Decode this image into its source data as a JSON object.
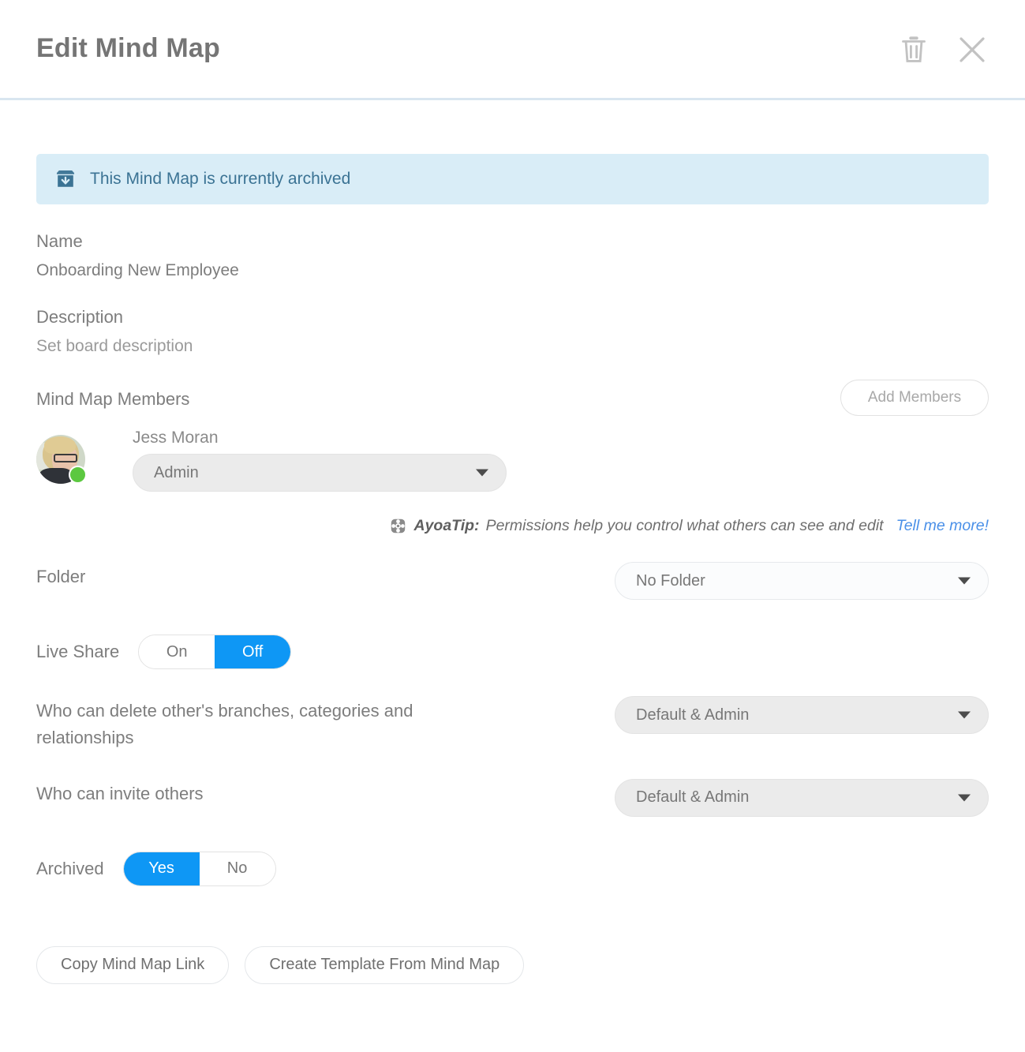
{
  "header": {
    "title": "Edit Mind Map",
    "delete_icon": "trash-icon",
    "close_icon": "close-icon"
  },
  "banner": {
    "icon": "archive-box-icon",
    "text": "This Mind Map is currently archived",
    "background_color": "#d9edf7",
    "text_color": "#3b7394"
  },
  "name": {
    "label": "Name",
    "value": "Onboarding New Employee"
  },
  "description": {
    "label": "Description",
    "value": "Set board description"
  },
  "members": {
    "label": "Mind Map Members",
    "add_button": "Add Members",
    "list": [
      {
        "name": "Jess Moran",
        "role": "Admin",
        "status": "online",
        "status_color": "#5cc840"
      }
    ]
  },
  "tip": {
    "icon": "ayoa-logo-icon",
    "prefix": "AyoaTip:",
    "text": "Permissions help you control what others can see and edit",
    "link": "Tell me more!",
    "link_color": "#4a90e8"
  },
  "folder": {
    "label": "Folder",
    "value": "No Folder"
  },
  "live_share": {
    "label": "Live Share",
    "options": [
      "On",
      "Off"
    ],
    "selected": "Off"
  },
  "delete_permission": {
    "label": "Who can delete other's branches, categories and relationships",
    "value": "Default & Admin"
  },
  "invite_permission": {
    "label": "Who can invite others",
    "value": "Default & Admin"
  },
  "archived": {
    "label": "Archived",
    "options": [
      "Yes",
      "No"
    ],
    "selected": "Yes"
  },
  "footer": {
    "copy_link": "Copy Mind Map Link",
    "create_template": "Create Template From Mind Map"
  },
  "theme": {
    "accent_blue": "#0e97f5",
    "text_gray": "#7d7d7d"
  }
}
